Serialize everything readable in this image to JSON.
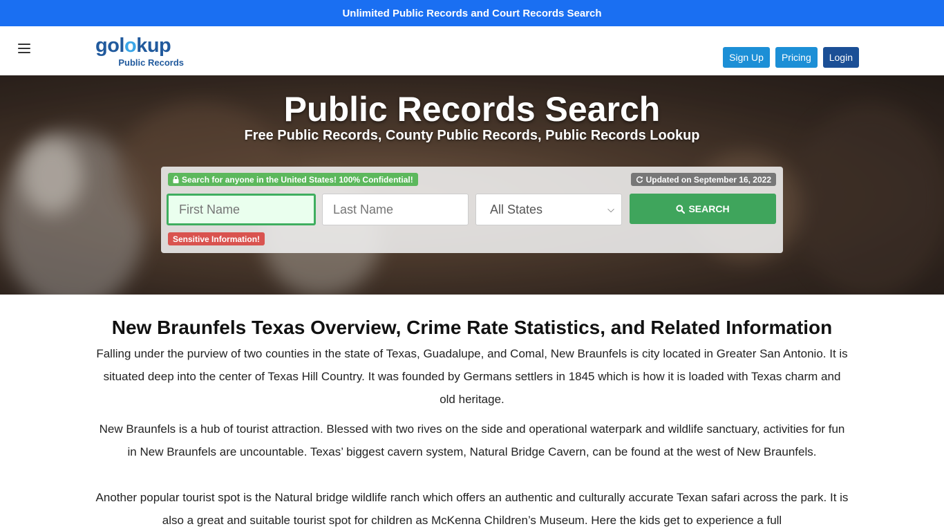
{
  "promo_bar": {
    "text": "Unlimited Public Records and Court Records Search"
  },
  "navbar": {
    "logo": {
      "word_start": "gol",
      "word_o": "o",
      "word_end": "kup",
      "subtitle": "Public Records"
    },
    "buttons": {
      "signup": "Sign Up",
      "pricing": "Pricing",
      "login": "Login"
    }
  },
  "hero": {
    "title": "Public Records Search",
    "subtitle": "Free Public Records, County Public Records, Public Records Lookup"
  },
  "search": {
    "confidential_badge": "Search for anyone in the United States! 100% Confidential!",
    "updated_badge": "Updated on September 16, 2022",
    "first_name_placeholder": "First Name",
    "last_name_placeholder": "Last Name",
    "state_selected": "All States",
    "search_button": "SEARCH",
    "sensitive_badge": "Sensitive Information!"
  },
  "article": {
    "heading": "New Braunfels Texas Overview, Crime Rate Statistics, and Related Information",
    "paragraphs": [
      "Falling under the purview of two counties in the state of Texas, Guadalupe, and Comal, New Braunfels is city located in Greater San Antonio. It is situated deep into the center of Texas Hill Country. It was founded by Germans settlers in 1845 which is how it is loaded with Texas charm and old heritage.",
      "New Braunfels is a hub of tourist attraction. Blessed with two rives on the side and operational waterpark and wildlife sanctuary, activities for fun in New Braunfels are uncountable. Texas’ biggest cavern system, Natural Bridge Cavern, can be found at the west of New Braunfels.",
      "Another popular tourist spot is the Natural bridge wildlife ranch which offers an authentic and culturally accurate Texan safari across the park. It is also a great and suitable tourist spot for children as McKenna Children’s Museum. Here the kids get to experience a full"
    ]
  },
  "colors": {
    "promo_blue": "#1a6ff2",
    "brand_blue": "#1c8fd6",
    "login_blue": "#1b4f96",
    "search_green": "#3fa55c",
    "sensitive_red": "#d9534f"
  },
  "icons": [
    "menu-icon",
    "lock-icon",
    "refresh-icon",
    "search-icon",
    "chevron-down-icon"
  ]
}
